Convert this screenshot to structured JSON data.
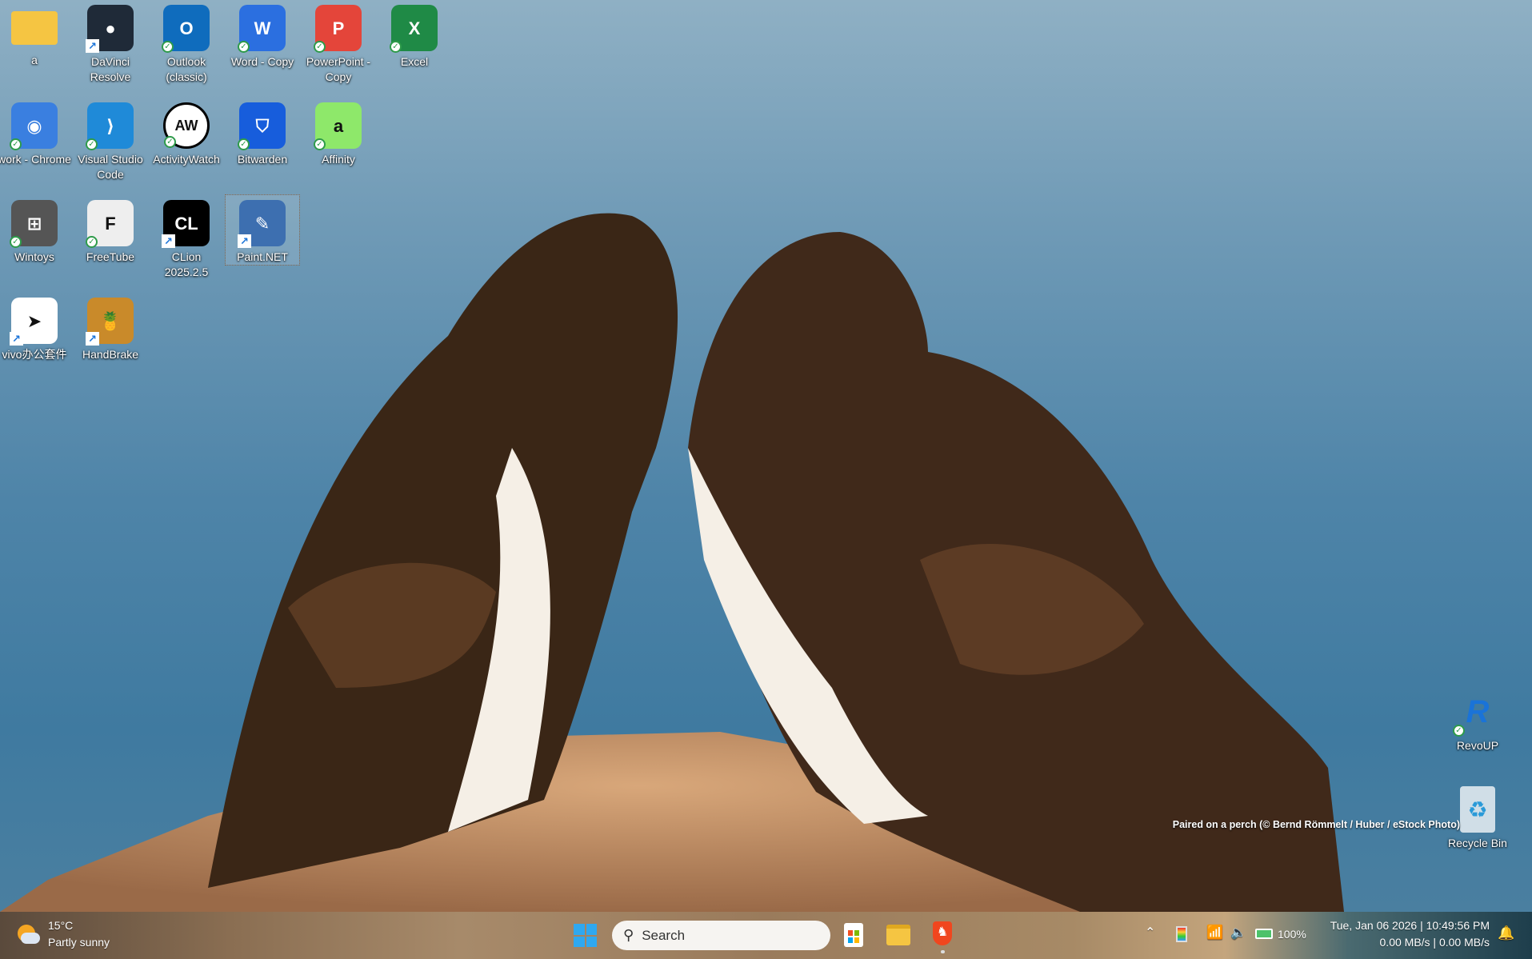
{
  "desktop": {
    "icons": [
      {
        "label": "a",
        "icon": "folder-icon",
        "color": "#f5c542",
        "glyph": ""
      },
      {
        "label": "DaVinci Resolve",
        "icon": "davinci-resolve-icon",
        "color": "#1f2a38",
        "glyph": "●"
      },
      {
        "label": "Outlook (classic)",
        "icon": "outlook-icon",
        "color": "#0f6cbd",
        "glyph": "O"
      },
      {
        "label": "Word - Copy",
        "icon": "word-icon",
        "color": "#2b6fe0",
        "glyph": "W"
      },
      {
        "label": "PowerPoint - Copy",
        "icon": "powerpoint-icon",
        "color": "#e4453a",
        "glyph": "P"
      },
      {
        "label": "Excel",
        "icon": "excel-icon",
        "color": "#1f8a46",
        "glyph": "X"
      },
      {
        "label": "work - Chrome",
        "icon": "chrome-icon",
        "color": "#3a7fe0",
        "glyph": "◉"
      },
      {
        "label": "Visual Studio Code",
        "icon": "vscode-icon",
        "color": "#1f8ad8",
        "glyph": "⟩"
      },
      {
        "label": "ActivityWatch",
        "icon": "activitywatch-icon",
        "color": "#ffffff",
        "glyph": "AW"
      },
      {
        "label": "Bitwarden",
        "icon": "bitwarden-icon",
        "color": "#175ddc",
        "glyph": "⛉"
      },
      {
        "label": "Affinity",
        "icon": "affinity-icon",
        "color": "#8ee86a",
        "glyph": "a"
      },
      {
        "label": "Wintoys",
        "icon": "wintoys-icon",
        "color": "#555555",
        "glyph": "⊞"
      },
      {
        "label": "FreeTube",
        "icon": "freetube-icon",
        "color": "#eeeeee",
        "glyph": "F"
      },
      {
        "label": "CLion 2025.2.5",
        "icon": "clion-icon",
        "color": "#000000",
        "glyph": "CL"
      },
      {
        "label": "Paint.NET",
        "icon": "paintnet-icon",
        "color": "#3d6fb0",
        "glyph": "✎"
      },
      {
        "label": "vivo办公套件",
        "icon": "vivo-office-icon",
        "color": "#ffffff",
        "glyph": "➤"
      },
      {
        "label": "HandBrake",
        "icon": "handbrake-icon",
        "color": "#c98a2a",
        "glyph": "🍍"
      }
    ],
    "right_icons": [
      {
        "label": "RevoUP",
        "icon": "revoup-icon"
      },
      {
        "label": "Recycle Bin",
        "icon": "recycle-bin-icon"
      }
    ],
    "wallpaper_caption": "Paired on a perch (© Bernd Römmelt / Huber / eStock Photo)"
  },
  "taskbar": {
    "weather": {
      "temp": "15°C",
      "condition": "Partly sunny",
      "icon": "partly-sunny-icon"
    },
    "search_placeholder": "Search",
    "battery": "100%",
    "datetime": "Tue, Jan 06 2026 | 10:49:56 PM",
    "network_speed": "0.00 MB/s | 0.00 MB/s"
  }
}
